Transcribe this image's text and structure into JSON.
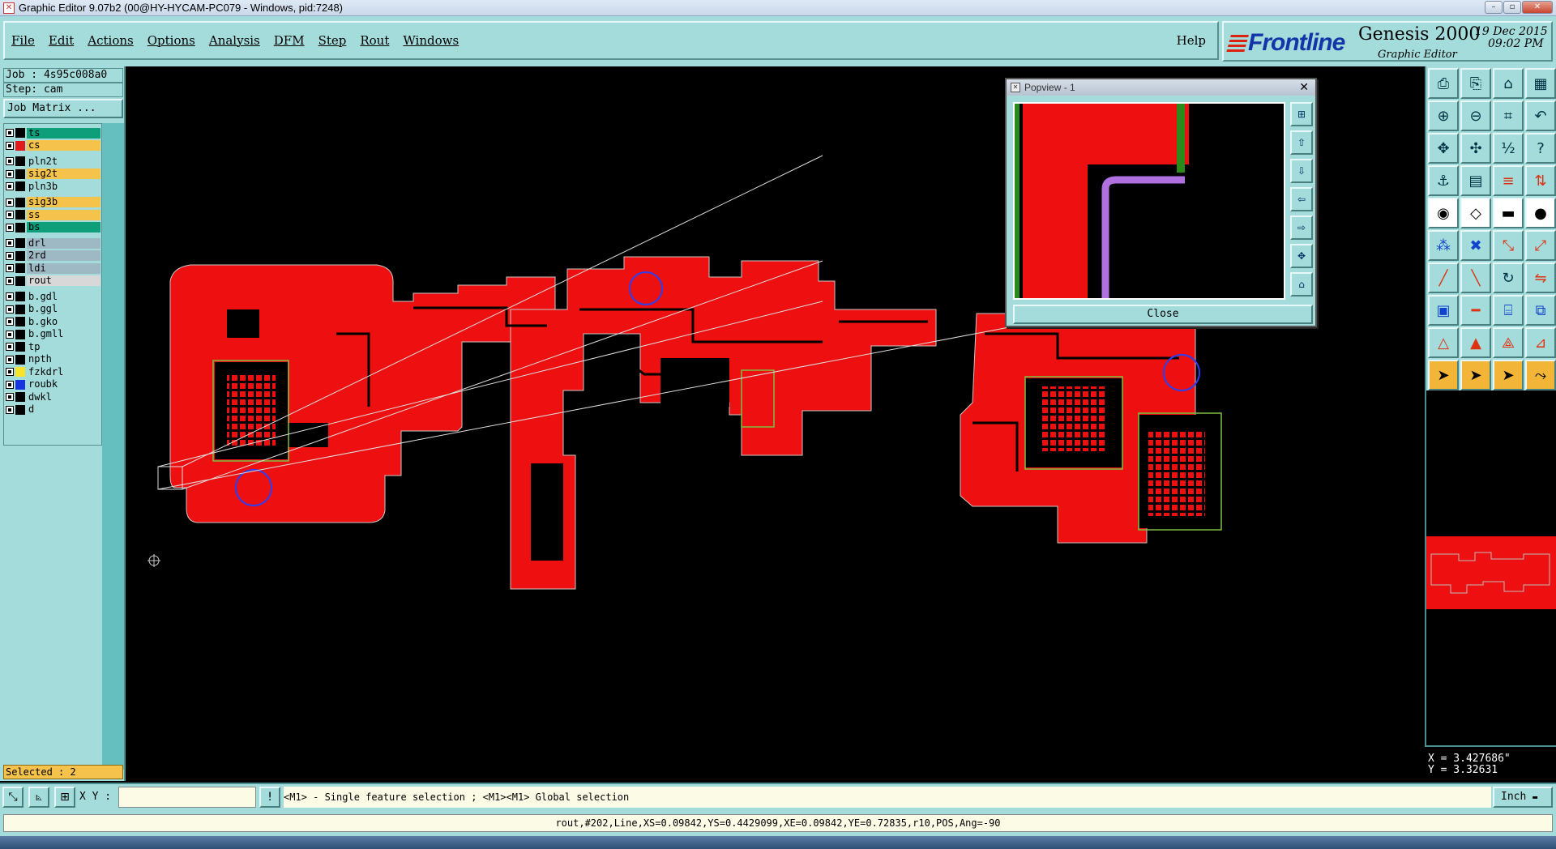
{
  "window": {
    "title": "Graphic Editor 9.07b2 (00@HY-HYCAM-PC079 - Windows, pid:7248)"
  },
  "menu": {
    "items": [
      "File",
      "Edit",
      "Actions",
      "Options",
      "Analysis",
      "DFM",
      "Step",
      "Rout",
      "Windows"
    ],
    "help": "Help"
  },
  "brand": {
    "logo": "Frontline",
    "product": "Genesis 2000",
    "subtitle": "Graphic Editor",
    "date": "19 Dec 2015",
    "time": "09:02 PM"
  },
  "job": {
    "job_line": "Job : 4s95c008a0",
    "step_line": "Step: cam",
    "matrix_button": "Job Matrix ..."
  },
  "layers": [
    {
      "name": "ts",
      "color": "#0f9e7a",
      "swatch": "#000000"
    },
    {
      "name": "cs",
      "color": "#f5c34b",
      "swatch": "#e11b1b"
    },
    {
      "name": "pln2t",
      "color": "#a4dcdc",
      "swatch": "#000000"
    },
    {
      "name": "sig2t",
      "color": "#f5c34b",
      "swatch": "#000000"
    },
    {
      "name": "pln3b",
      "color": "#a4dcdc",
      "swatch": "#000000"
    },
    {
      "name": "sig3b",
      "color": "#f5c34b",
      "swatch": "#000000"
    },
    {
      "name": "ss",
      "color": "#f5c34b",
      "swatch": "#000000"
    },
    {
      "name": "bs",
      "color": "#0f9e7a",
      "swatch": "#000000"
    },
    {
      "name": "drl",
      "color": "#9fb9c4",
      "swatch": "#000000"
    },
    {
      "name": "2rd",
      "color": "#9fb9c4",
      "swatch": "#000000"
    },
    {
      "name": "ldi",
      "color": "#9fb9c4",
      "swatch": "#000000"
    },
    {
      "name": "rout",
      "color": "#d8d8d8",
      "swatch": "#000000"
    },
    {
      "name": "b.gdl",
      "color": "#a4dcdc",
      "swatch": "#000000"
    },
    {
      "name": "b.ggl",
      "color": "#a4dcdc",
      "swatch": "#000000"
    },
    {
      "name": "b.gko",
      "color": "#a4dcdc",
      "swatch": "#000000"
    },
    {
      "name": "b.gmll",
      "color": "#a4dcdc",
      "swatch": "#000000"
    },
    {
      "name": "tp",
      "color": "#a4dcdc",
      "swatch": "#000000"
    },
    {
      "name": "npth",
      "color": "#a4dcdc",
      "swatch": "#000000"
    },
    {
      "name": "fzkdrl",
      "color": "#a4dcdc",
      "swatch": "#f7e32a"
    },
    {
      "name": "roubk",
      "color": "#a4dcdc",
      "swatch": "#1736e0"
    },
    {
      "name": "dwkl",
      "color": "#a4dcdc",
      "swatch": "#000000"
    },
    {
      "name": "d",
      "color": "#a4dcdc",
      "swatch": "#000000"
    }
  ],
  "selected": "Selected : 2",
  "popview": {
    "title": "Popview - 1",
    "close_label": "Close"
  },
  "coords": {
    "x": "X = 3.427686\"",
    "y": "Y = 3.32631"
  },
  "bottom": {
    "xy_label": "X Y :",
    "xy_value": "",
    "message": "<M1> - Single feature selection ; <M1><M1> Global selection",
    "unit": "Inch",
    "status": "rout,#202,Line,XS=0.09842,YS=0.4429099,XE=0.09842,YE=0.72835,r10,POS,Ang=-90"
  },
  "colors": {
    "panel": "#a4dcdc",
    "copper": "#ee1010",
    "highlight": "#f5c34b"
  }
}
